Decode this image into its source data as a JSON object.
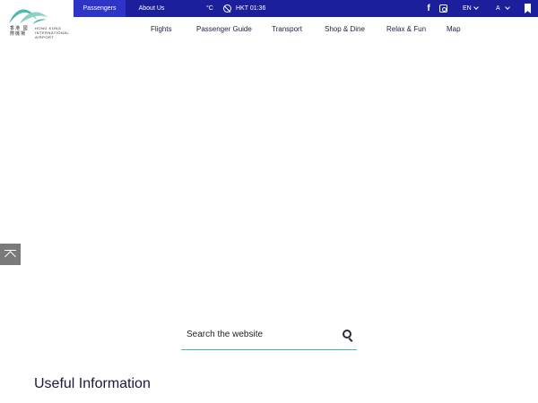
{
  "topbar": {
    "tabs": [
      {
        "label": "Passengers",
        "active": true
      },
      {
        "label": "About Us",
        "active": false
      }
    ],
    "weather": "°C",
    "time": "HKT 01:36",
    "language": "EN",
    "font_size": "A",
    "icons": [
      "clock-icon",
      "facebook-icon",
      "instagram-icon",
      "chevron-down-icon",
      "bookmark-icon"
    ]
  },
  "logo": {
    "chinese": "香港 國際機場",
    "english": "HONG KONG INTERNATIONAL AIRPORT"
  },
  "nav": {
    "items": [
      "Flights",
      "Passenger Guide",
      "Transport",
      "Shop & Dine",
      "Relax & Fun",
      "Map"
    ]
  },
  "search": {
    "placeholder": "Search the website"
  },
  "sections": {
    "useful_title": "Useful Information"
  },
  "colors": {
    "topbar": "#1c1f9c",
    "topbar_active": "#2e34c8",
    "logo_teal": "#4fb9b0",
    "search_underline": "#48b4b8",
    "back_to_top": "#7a7a7a"
  }
}
